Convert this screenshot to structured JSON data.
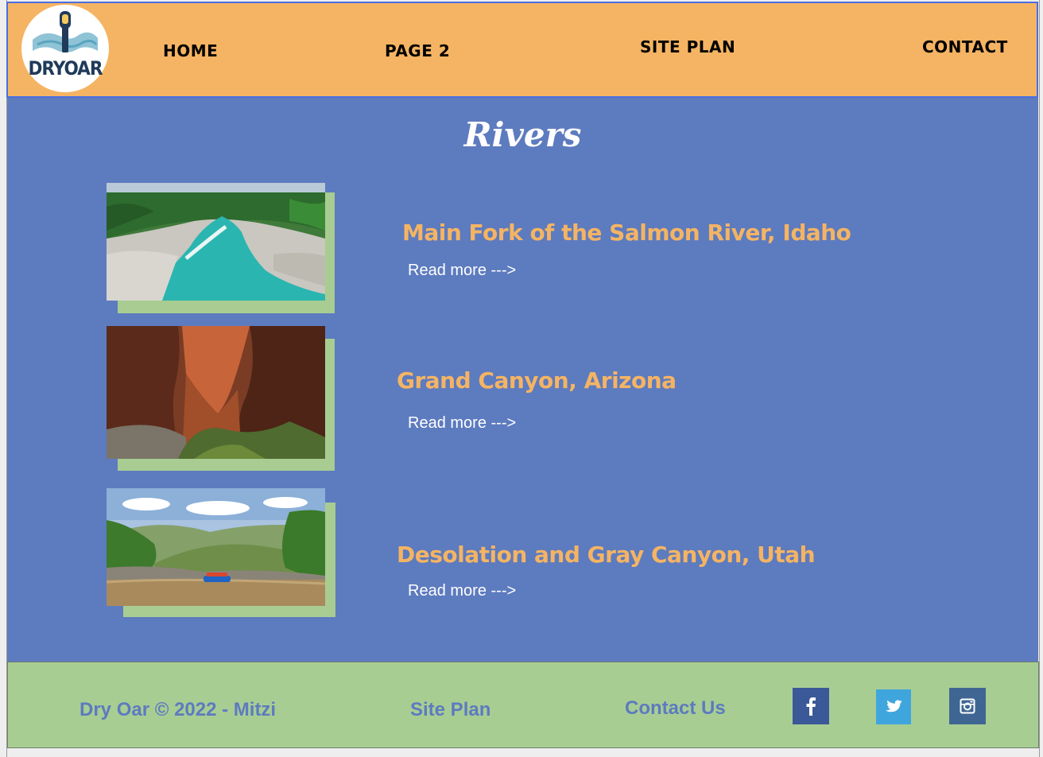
{
  "brand": {
    "logo_text": "DRYOAR"
  },
  "nav": {
    "items": [
      {
        "label": "HOME"
      },
      {
        "label": "PAGE 2"
      },
      {
        "label": "SITE PLAN"
      },
      {
        "label": "CONTACT"
      }
    ]
  },
  "main": {
    "title": "Rivers",
    "rivers": [
      {
        "title": "Main Fork of the Salmon River, Idaho",
        "link": "Read more --->"
      },
      {
        "title": "Grand Canyon, Arizona",
        "link": "Read more --->"
      },
      {
        "title": "Desolation and Gray Canyon, Utah",
        "link": "Read more --->"
      }
    ]
  },
  "footer": {
    "copyright": "Dry Oar © 2022 - Mitzi",
    "site_plan": "Site Plan",
    "contact": "Contact Us",
    "social": [
      {
        "icon": "facebook-icon",
        "color": "#3b5998"
      },
      {
        "icon": "twitter-icon",
        "color": "#3fa6dd"
      },
      {
        "icon": "instagram-icon",
        "color": "#3f6693"
      }
    ]
  },
  "colors": {
    "header_bg": "#f5b463",
    "main_bg": "#5d7bbf",
    "footer_bg": "#a8cd93",
    "accent_orange": "#f5b463",
    "shadow_green": "#a8cc91"
  }
}
